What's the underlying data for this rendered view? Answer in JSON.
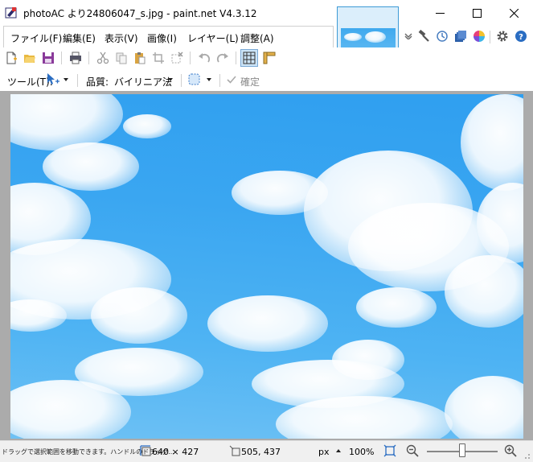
{
  "window": {
    "title": "photoAC より24806047_s.jpg - paint.net V4.3.12",
    "minimize_icon": "minimize-icon",
    "maximize_icon": "maximize-icon",
    "close_icon": "close-icon"
  },
  "menu": {
    "items": [
      "ファイル(F)",
      "編集(E)",
      "表示(V)",
      "画像(I)",
      "レイヤー(L)",
      "調整(A)"
    ],
    "right_icons": [
      "chevron-down-icon",
      "hammer-icon",
      "history-icon",
      "layers-icon",
      "color-wheel-icon",
      "gear-icon",
      "help-icon"
    ]
  },
  "image_tab": {
    "name": "photoAC より24806047_s.jpg"
  },
  "toolbar": {
    "icons": [
      "new-file-icon",
      "open-folder-icon",
      "save-icon",
      "print-icon",
      "cut-icon",
      "copy-icon",
      "paste-icon",
      "crop-icon",
      "deselect-icon",
      "undo-icon",
      "redo-icon",
      "grid-icon",
      "ruler-icon"
    ]
  },
  "tool_options": {
    "tool_label": "ツール(T):",
    "quality_label": "品質:",
    "quality_value": "バイリニア法",
    "confirm_label": "確定"
  },
  "status": {
    "hint": "ドラッグで選択範囲を移動できます。ハンドルのドラッグ...",
    "image_size": "640 × 427",
    "cursor_position": "505, 437",
    "unit": "px",
    "zoom": "100%",
    "zoom_level": 0.5
  },
  "colors": {
    "accent": "#3d9ad6",
    "sky": "#3aa6f1",
    "canvas_background": "#ababab"
  }
}
